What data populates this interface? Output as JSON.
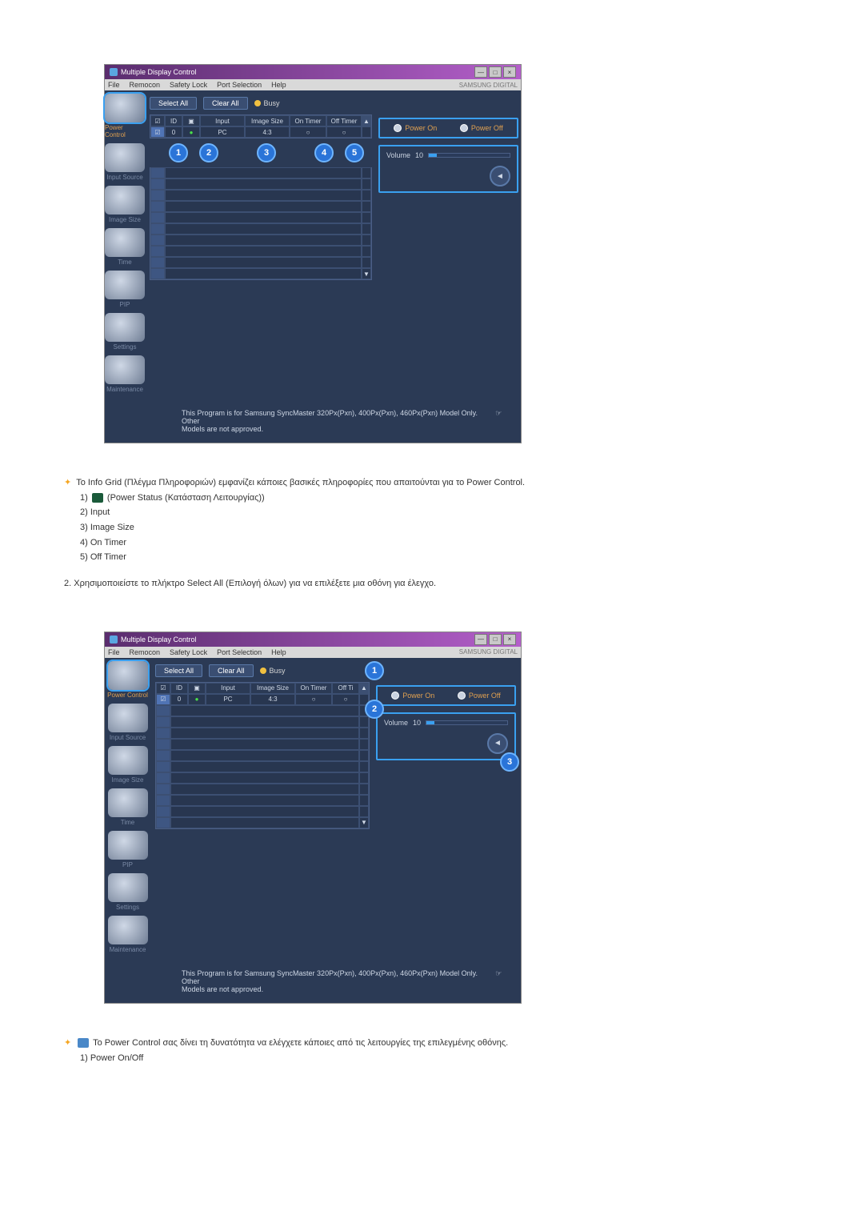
{
  "app_title": "Multiple Display Control",
  "menubar": [
    "File",
    "Remocon",
    "Safety Lock",
    "Port Selection",
    "Help"
  ],
  "brand": "SAMSUNG DIGITAL",
  "sidebar": {
    "items": [
      {
        "label": "Power Control"
      },
      {
        "label": "Input Source"
      },
      {
        "label": "Image Size"
      },
      {
        "label": "Time"
      },
      {
        "label": "PIP"
      },
      {
        "label": "Settings"
      },
      {
        "label": "Maintenance"
      }
    ]
  },
  "toolbar": {
    "select_all": "Select All",
    "clear_all": "Clear All",
    "busy": "Busy"
  },
  "grid": {
    "headers": [
      "",
      "ID",
      "",
      "Input",
      "Image Size",
      "On Timer",
      "Off Timer"
    ],
    "row": {
      "id": "0",
      "status": "●",
      "input": "PC",
      "image_size": "4:3",
      "on_timer": "○",
      "off_timer": "○"
    }
  },
  "right": {
    "power_on": "Power On",
    "power_off": "Power Off",
    "volume_label": "Volume",
    "volume_value": "10"
  },
  "footer1": "This Program is for Samsung SyncMaster 320Px(Pxn), 400Px(Pxn), 460Px(Pxn)  Model Only. Other",
  "footer2": "Models are not approved.",
  "doc": {
    "line1": "Το Info Grid (Πλέγμα Πληροφοριών) εμφανίζει κάποιες βασικές πληροφορίες που απαιτούνται για το Power Control.",
    "item1a": "1)",
    "item1b": "(Power Status (Κατάσταση Λειτουργίας))",
    "item2": "2) Input",
    "item3": "3) Image Size",
    "item4": "4) On Timer",
    "item5": "5) Off Timer",
    "line2": "2.  Χρησιμοποιείστε το πλήκτρο Select All (Επιλογή όλων) για να επιλέξετε μια οθόνη για έλεγχο.",
    "line3": "Το Power Control σας δίνει τη δυνατότητα να ελέγχετε κάποιες από τις λειτουργίες της επιλεγμένης οθόνης.",
    "item_b1": "1)  Power On/Off"
  },
  "nums_a": [
    "1",
    "2",
    "3",
    "4",
    "5"
  ],
  "nums_b": [
    "1",
    "2",
    "3"
  ]
}
